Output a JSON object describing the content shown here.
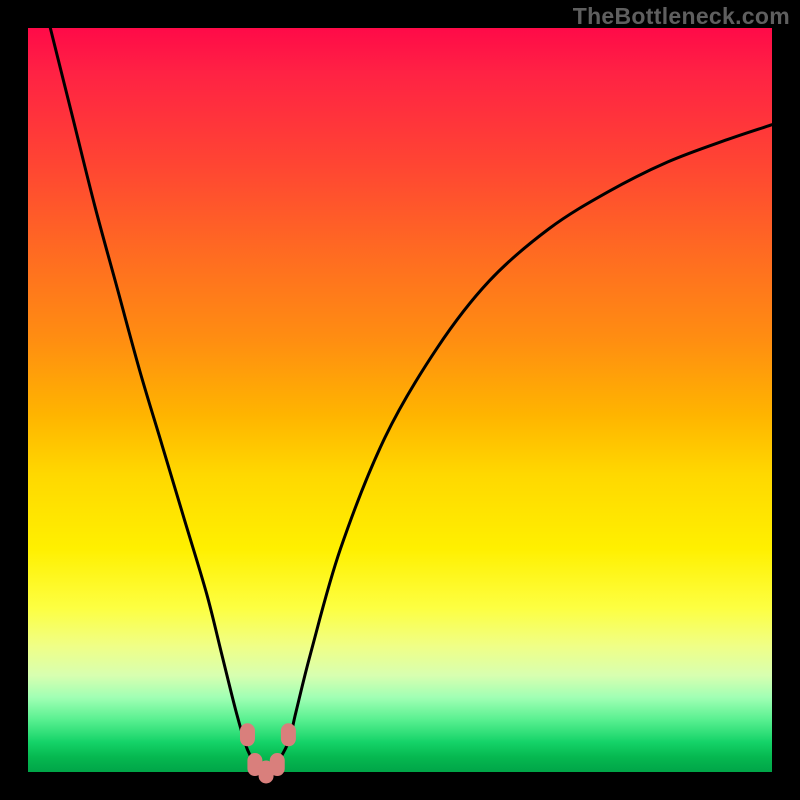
{
  "attribution": "TheBottleneck.com",
  "chart_data": {
    "type": "line",
    "title": "",
    "xlabel": "",
    "ylabel": "",
    "xlim": [
      0,
      100
    ],
    "ylim": [
      0,
      100
    ],
    "series": [
      {
        "name": "bottleneck-curve",
        "x": [
          3,
          6,
          9,
          12,
          15,
          18,
          21,
          24,
          26,
          28,
          29.5,
          31,
          32,
          33,
          35,
          36,
          38,
          42,
          48,
          55,
          62,
          70,
          78,
          86,
          94,
          100
        ],
        "y": [
          100,
          88,
          76,
          65,
          54,
          44,
          34,
          24,
          16,
          8,
          3,
          0.5,
          0,
          0.5,
          4,
          8,
          16,
          30,
          45,
          57,
          66,
          73,
          78,
          82,
          85,
          87
        ]
      }
    ],
    "markers": [
      {
        "name": "marker-left-upper",
        "x": 29.5,
        "y": 5,
        "color": "#d97f7c"
      },
      {
        "name": "marker-left-lower",
        "x": 30.5,
        "y": 1,
        "color": "#d97f7c"
      },
      {
        "name": "marker-mid",
        "x": 32,
        "y": 0,
        "color": "#d97f7c"
      },
      {
        "name": "marker-right-lower",
        "x": 33.5,
        "y": 1,
        "color": "#d97f7c"
      },
      {
        "name": "marker-right-upper",
        "x": 35,
        "y": 5,
        "color": "#d97f7c"
      }
    ],
    "marker_radius_px": 10
  }
}
